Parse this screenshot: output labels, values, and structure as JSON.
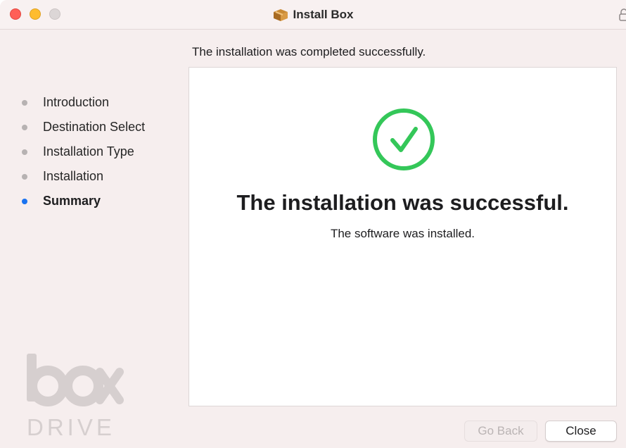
{
  "window": {
    "title": "Install Box"
  },
  "status_heading": "The installation was completed successfully.",
  "sidebar": {
    "steps": [
      {
        "label": "Introduction",
        "active": false
      },
      {
        "label": "Destination Select",
        "active": false
      },
      {
        "label": "Installation Type",
        "active": false
      },
      {
        "label": "Installation",
        "active": false
      },
      {
        "label": "Summary",
        "active": true
      }
    ]
  },
  "logo": {
    "word": "box",
    "subtitle": "DRIVE"
  },
  "panel": {
    "title": "The installation was successful.",
    "subtitle": "The software was installed."
  },
  "buttons": {
    "go_back": "Go Back",
    "close": "Close"
  },
  "icons": {
    "package": "package-icon",
    "success": "success-check-icon",
    "lock": "lock-icon"
  },
  "colors": {
    "success_green": "#34c759",
    "active_step": "#1a73f0",
    "inactive_step": "#b7b2b2",
    "traffic_close": "#ff5f57",
    "traffic_minimize": "#febc2e"
  }
}
